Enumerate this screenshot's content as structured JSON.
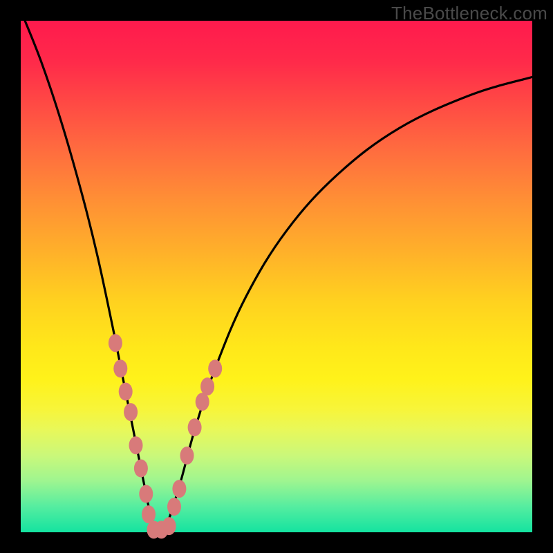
{
  "watermark": "TheBottleneck.com",
  "chart_data": {
    "type": "line",
    "title": "",
    "xlabel": "",
    "ylabel": "",
    "xlim": [
      0,
      100
    ],
    "ylim": [
      0,
      100
    ],
    "series": [
      {
        "name": "bottleneck-curve",
        "x": [
          0,
          4,
          8,
          12,
          15,
          18,
          20,
          22,
          24,
          25.5,
          27,
          28,
          31,
          34,
          38,
          44,
          52,
          62,
          74,
          88,
          100
        ],
        "y": [
          102,
          92,
          80,
          66,
          54,
          40,
          30,
          20,
          10,
          3,
          0,
          0,
          9,
          20,
          32,
          46,
          59,
          70,
          79,
          85.5,
          89
        ]
      }
    ],
    "markers": {
      "name": "data-beads",
      "color": "#d87a7a",
      "points": [
        {
          "x": 18.5,
          "y": 37
        },
        {
          "x": 19.5,
          "y": 32
        },
        {
          "x": 20.5,
          "y": 27.5
        },
        {
          "x": 21.5,
          "y": 23.5
        },
        {
          "x": 22.5,
          "y": 17
        },
        {
          "x": 23.5,
          "y": 12.5
        },
        {
          "x": 24.5,
          "y": 7.5
        },
        {
          "x": 25.0,
          "y": 3.5
        },
        {
          "x": 26.0,
          "y": 0.5
        },
        {
          "x": 27.5,
          "y": 0.5
        },
        {
          "x": 29.0,
          "y": 1.2
        },
        {
          "x": 30.0,
          "y": 5
        },
        {
          "x": 31.0,
          "y": 8.5
        },
        {
          "x": 32.5,
          "y": 15
        },
        {
          "x": 34.0,
          "y": 20.5
        },
        {
          "x": 35.5,
          "y": 25.5
        },
        {
          "x": 36.5,
          "y": 28.5
        },
        {
          "x": 38.0,
          "y": 32
        }
      ]
    }
  }
}
